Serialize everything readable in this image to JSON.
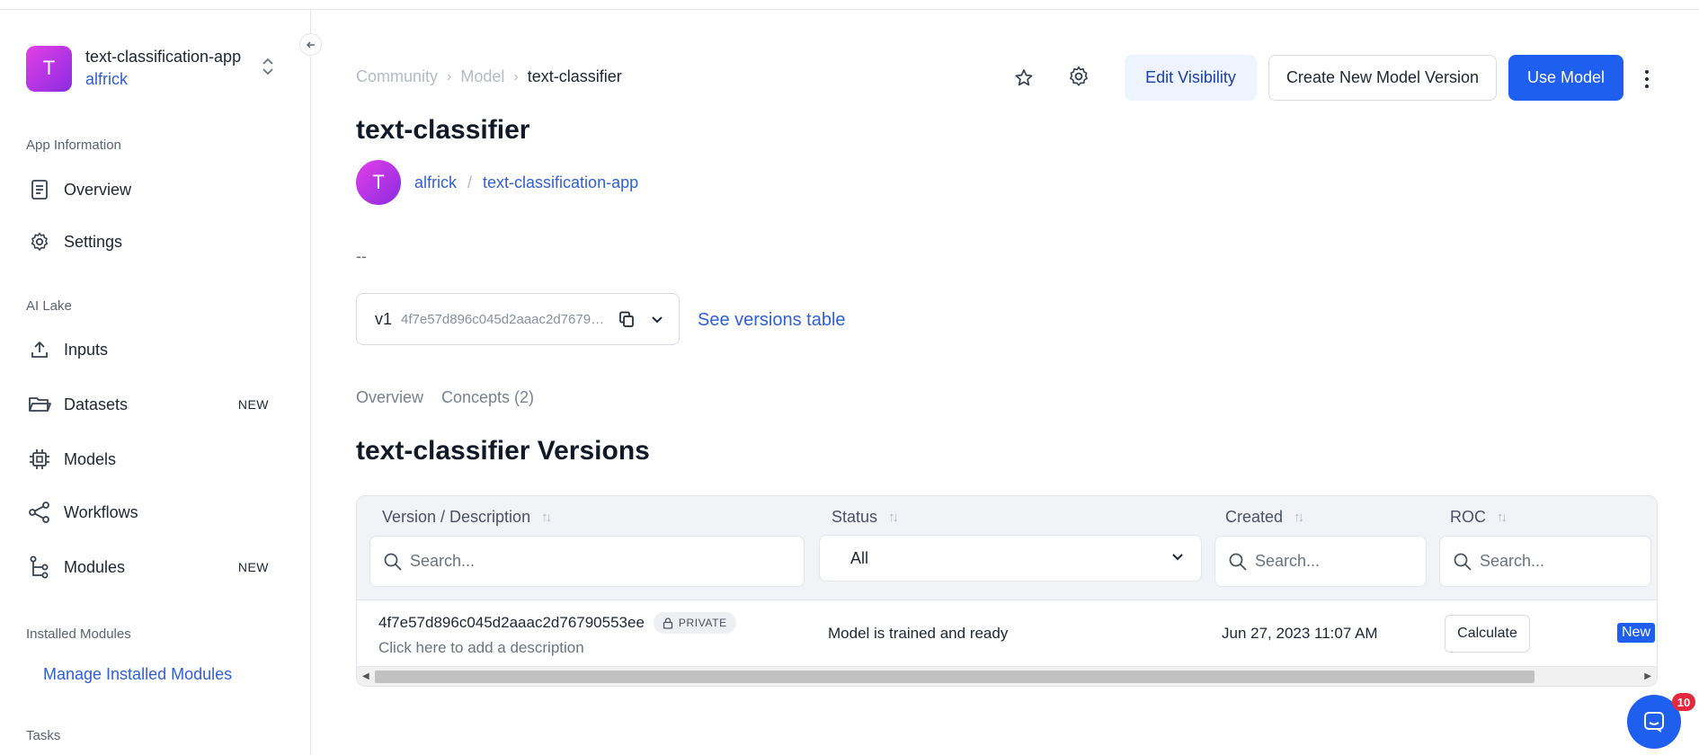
{
  "app": {
    "avatar_letter": "T",
    "name": "text-classification-app",
    "user": "alfrick"
  },
  "sidebar": {
    "sections": {
      "app_information": "App Information",
      "ai_lake": "AI Lake",
      "installed_modules": "Installed Modules",
      "tasks": "Tasks"
    },
    "items": {
      "overview": "Overview",
      "settings": "Settings",
      "inputs": "Inputs",
      "datasets": "Datasets",
      "datasets_badge": "NEW",
      "models": "Models",
      "workflows": "Workflows",
      "modules": "Modules",
      "modules_badge": "NEW"
    },
    "manage_installed_modules": "Manage Installed Modules"
  },
  "breadcrumb": {
    "community": "Community",
    "model": "Model",
    "current": "text-classifier"
  },
  "toolbar": {
    "edit_visibility": "Edit Visibility",
    "create_version": "Create New Model Version",
    "use_model": "Use Model"
  },
  "model": {
    "title": "text-classifier",
    "owner_avatar_letter": "T",
    "owner": "alfrick",
    "separator": "/",
    "app": "text-classification-app",
    "description": "--"
  },
  "version_select": {
    "tag": "v1",
    "hash": "4f7e57d896c045d2aaac2d76790553ee",
    "see_versions": "See versions table"
  },
  "tabs": {
    "overview": "Overview",
    "concepts": "Concepts (2)"
  },
  "versions": {
    "title": "text-classifier Versions",
    "columns": {
      "version": "Version / Description",
      "status": "Status",
      "created": "Created",
      "roc": "ROC"
    },
    "filters": {
      "search_placeholder": "Search...",
      "status_value": "All"
    },
    "rows": [
      {
        "hash": "4f7e57d896c045d2aaac2d76790553ee",
        "visibility": "PRIVATE",
        "description": "Click here to add a description",
        "status": "Model is trained and ready",
        "created": "Jun 27, 2023 11:07 AM",
        "roc_action": "Calculate",
        "extra_tag": "New"
      }
    ]
  },
  "chat": {
    "count": "10"
  },
  "colors": {
    "primary": "#1f5ff0",
    "link": "#2f5fd8",
    "avatar_gradient_start": "#e340e6",
    "avatar_gradient_end": "#8a2be2"
  }
}
